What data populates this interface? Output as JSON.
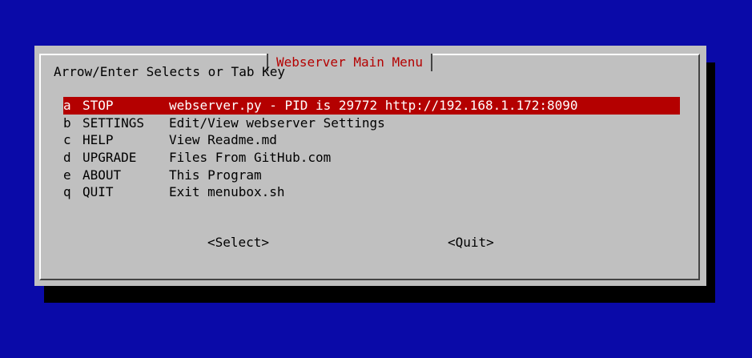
{
  "dialog": {
    "title": "Webserver Main Menu",
    "hint": "Arrow/Enter Selects or Tab Key",
    "items": [
      {
        "key": "a",
        "tag": "STOP",
        "desc": "webserver.py - PID is 29772 http://192.168.1.172:8090",
        "selected": true
      },
      {
        "key": "b",
        "tag": "SETTINGS",
        "desc": "Edit/View webserver Settings",
        "selected": false
      },
      {
        "key": "c",
        "tag": "HELP",
        "desc": "View Readme.md",
        "selected": false
      },
      {
        "key": "d",
        "tag": "UPGRADE",
        "desc": "Files From GitHub.com",
        "selected": false
      },
      {
        "key": "e",
        "tag": "ABOUT",
        "desc": "This Program",
        "selected": false
      },
      {
        "key": "q",
        "tag": "QUIT",
        "desc": "Exit menubox.sh",
        "selected": false
      }
    ],
    "buttons": {
      "select": "<Select>",
      "quit": "<Quit>"
    }
  },
  "colors": {
    "background": "#0a0aa8",
    "dialog": "#c0c0c0",
    "highlight": "#b40000",
    "title": "#b40000"
  }
}
